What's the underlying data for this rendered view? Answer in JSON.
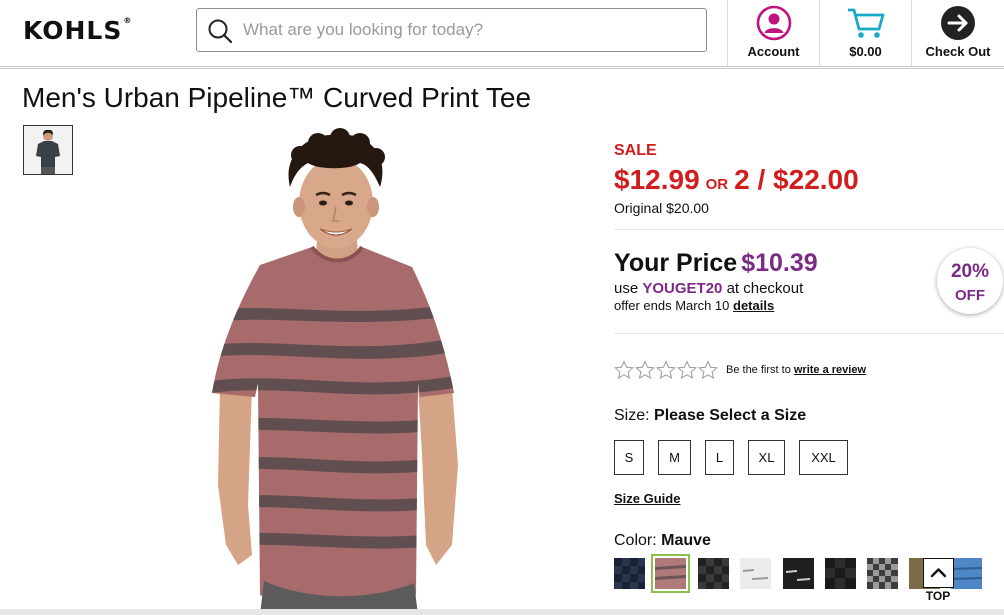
{
  "header": {
    "logo_text": "KOHLS",
    "search_placeholder": "What are you looking for today?",
    "account_label": "Account",
    "cart_label": "$0.00",
    "checkout_label": "Check Out",
    "brand_color": "#111111",
    "account_color": "#c2127e",
    "cart_color": "#1aa8c9"
  },
  "product": {
    "title": "Men's Urban Pipeline™ Curved Print Tee",
    "sale_label": "SALE",
    "sale_price": "$12.99",
    "or_label": "OR",
    "multi_price": "2 / $22.00",
    "original_price": "Original $20.00",
    "your_price_label": "Your Price",
    "your_price_value": "$10.39",
    "use_prefix": "use",
    "promo_code": "YOUGET20",
    "use_suffix": "at checkout",
    "offer_text": "offer ends March 10",
    "details_link": "details",
    "badge_pct": "20%",
    "badge_off": "OFF",
    "sale_color": "#d11d1d",
    "promo_color": "#7b2a86"
  },
  "reviews": {
    "stars_filled": 0,
    "stars_total": 5,
    "prefix": "Be the first to",
    "link": "write a review"
  },
  "size": {
    "label": "Size:",
    "value": "Please Select a Size",
    "options": [
      "S",
      "M",
      "L",
      "XL",
      "XXL"
    ],
    "guide_link": "Size Guide"
  },
  "color": {
    "label": "Color:",
    "value": "Mauve",
    "selected_index": 1,
    "swatches": [
      "navy-check",
      "mauve",
      "charcoal-check",
      "white-print",
      "black-print",
      "charcoal-dark",
      "gray-check",
      "olive",
      "blue-stripe"
    ]
  },
  "top_button": "TOP"
}
